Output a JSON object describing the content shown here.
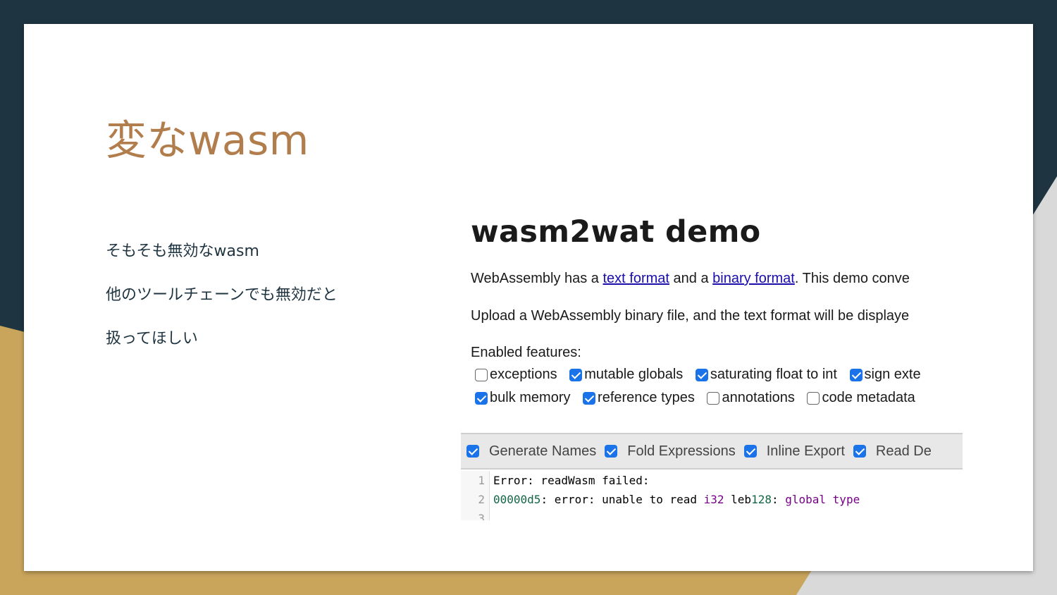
{
  "slide": {
    "title": "変なwasm",
    "bullets": [
      "そもそも無効なwasm",
      "他のツールチェーンでも無効だと",
      "扱ってほしい"
    ]
  },
  "screenshot": {
    "heading": "wasm2wat demo",
    "intro": {
      "prefix": "WebAssembly has a ",
      "link1": "text format",
      "middle": " and a ",
      "link2": "binary format",
      "suffix": ". This demo conve"
    },
    "upload_text": "Upload a WebAssembly binary file, and the text format will be displaye",
    "features_label": "Enabled features:",
    "features_row1": [
      {
        "label": "exceptions",
        "checked": false
      },
      {
        "label": "mutable globals",
        "checked": true
      },
      {
        "label": "saturating float to int",
        "checked": true
      },
      {
        "label": "sign exte",
        "checked": true
      }
    ],
    "features_row2": [
      {
        "label": "bulk memory",
        "checked": true
      },
      {
        "label": "reference types",
        "checked": true
      },
      {
        "label": "annotations",
        "checked": false
      },
      {
        "label": "code metadata",
        "checked": false
      }
    ],
    "options": [
      {
        "label": "Generate Names",
        "checked": true
      },
      {
        "label": "Fold Expressions",
        "checked": true
      },
      {
        "label": "Inline Export",
        "checked": true
      },
      {
        "label": "Read De",
        "checked": true
      }
    ],
    "editor": {
      "line_numbers": [
        "1",
        "2",
        "3"
      ],
      "line1": "Error: readWasm failed:",
      "line2": {
        "addr": "00000d5",
        "text1": ": error: unable to read ",
        "i32": "i32",
        "leb": " leb",
        "leb_num": "128",
        "colon": ": ",
        "global": "global",
        "space": " ",
        "type": "type"
      }
    }
  },
  "colors": {
    "background_dark": "#1f3441",
    "background_gold": "#c9a55c",
    "background_gray": "#d9d9d9",
    "title_color": "#b27d4c",
    "text_color": "#1f3441"
  }
}
